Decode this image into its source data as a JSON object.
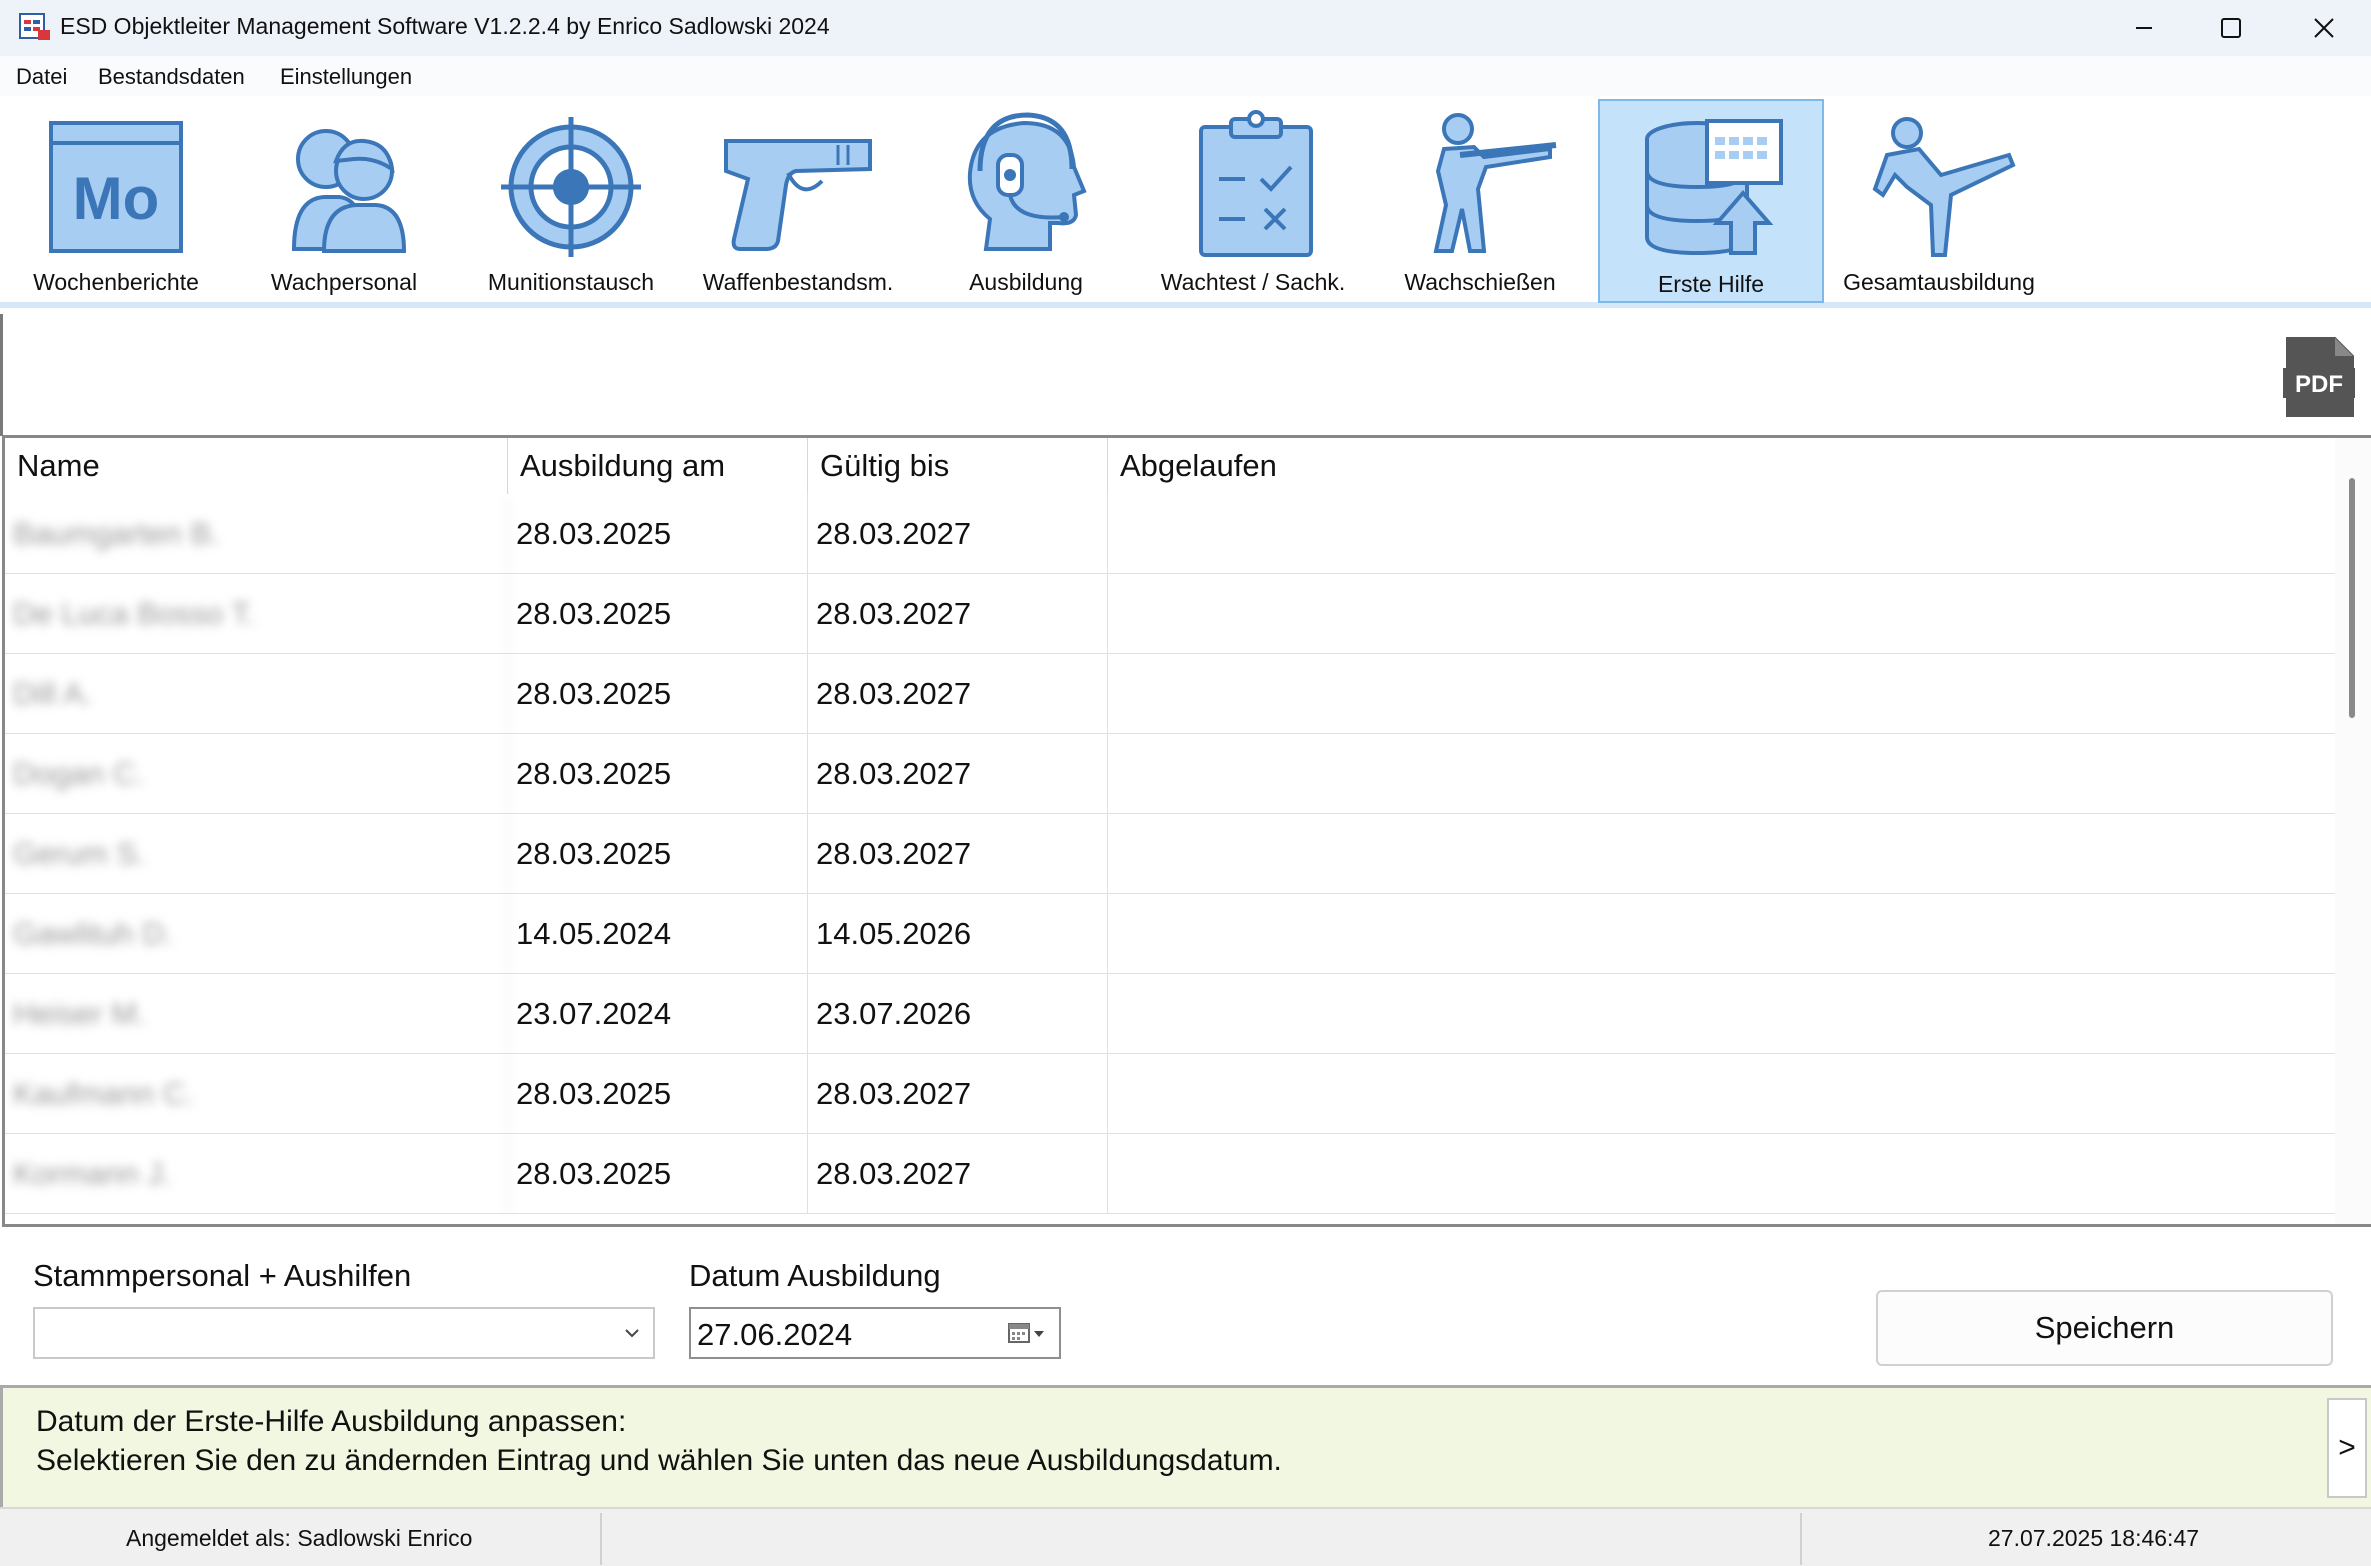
{
  "window": {
    "title": "ESD Objektleiter Management Software V1.2.2.4 by Enrico Sadlowski 2024"
  },
  "menu": {
    "items": [
      {
        "label": "Datei"
      },
      {
        "label": "Bestandsdaten"
      },
      {
        "label": "Einstellungen"
      }
    ]
  },
  "toolbar": {
    "items": [
      {
        "label": "Wochenberichte",
        "icon": "mo-calendar-icon",
        "icon_text": "Mo"
      },
      {
        "label": "Wachpersonal",
        "icon": "people-icon"
      },
      {
        "label": "Munitionstausch",
        "icon": "target-icon"
      },
      {
        "label": "Waffenbestandsm.",
        "icon": "pistol-icon"
      },
      {
        "label": "Ausbildung",
        "icon": "headset-person-icon"
      },
      {
        "label": "Wachtest / Sachk.",
        "icon": "clipboard-checklist-icon"
      },
      {
        "label": "Wachschießen",
        "icon": "rifle-shooter-icon"
      },
      {
        "label": "Erste Hilfe",
        "icon": "database-upload-icon",
        "active": true
      },
      {
        "label": "Gesamtausbildung",
        "icon": "martial-arts-kick-icon"
      }
    ]
  },
  "pdf_button": {
    "icon": "pdf-icon",
    "label": "PDF"
  },
  "table": {
    "columns": [
      "Name",
      "Ausbildung am",
      "Gültig bis",
      "Abgelaufen"
    ],
    "rows": [
      {
        "name": "Baumgarten B.",
        "ausbildung_am": "28.03.2025",
        "gueltig_bis": "28.03.2027",
        "abgelaufen": ""
      },
      {
        "name": "De Luca Bosso T.",
        "ausbildung_am": "28.03.2025",
        "gueltig_bis": "28.03.2027",
        "abgelaufen": ""
      },
      {
        "name": "Dill A.",
        "ausbildung_am": "28.03.2025",
        "gueltig_bis": "28.03.2027",
        "abgelaufen": ""
      },
      {
        "name": "Dogan C.",
        "ausbildung_am": "28.03.2025",
        "gueltig_bis": "28.03.2027",
        "abgelaufen": ""
      },
      {
        "name": "Gerum S.",
        "ausbildung_am": "28.03.2025",
        "gueltig_bis": "28.03.2027",
        "abgelaufen": ""
      },
      {
        "name": "Gawlituh D.",
        "ausbildung_am": "14.05.2024",
        "gueltig_bis": "14.05.2026",
        "abgelaufen": ""
      },
      {
        "name": "Heiser M.",
        "ausbildung_am": "23.07.2024",
        "gueltig_bis": "23.07.2026",
        "abgelaufen": ""
      },
      {
        "name": "Kaufmann C.",
        "ausbildung_am": "28.03.2025",
        "gueltig_bis": "28.03.2027",
        "abgelaufen": ""
      },
      {
        "name": "Kormann J.",
        "ausbildung_am": "28.03.2025",
        "gueltig_bis": "28.03.2027",
        "abgelaufen": ""
      }
    ]
  },
  "form": {
    "staff_label": "Stammpersonal + Aushilfen",
    "staff_value": "",
    "date_label": "Datum Ausbildung",
    "date_value": "27.06.2024",
    "save_label": "Speichern"
  },
  "info": {
    "line1": "Datum der Erste-Hilfe Ausbildung anpassen:",
    "line2": "Selektieren Sie den zu ändernden Eintrag und wählen Sie unten das neue Ausbildungsdatum.",
    "toggle_label": ">"
  },
  "status": {
    "user": "Angemeldet als: Sadlowski Enrico",
    "datetime": "27.07.2025 18:46:47"
  },
  "colors": {
    "icon_fill": "#a8cdf3",
    "icon_stroke": "#3b76b9",
    "active_tab_bg": "#c5e2fb",
    "info_bg": "#f1f7e0"
  }
}
